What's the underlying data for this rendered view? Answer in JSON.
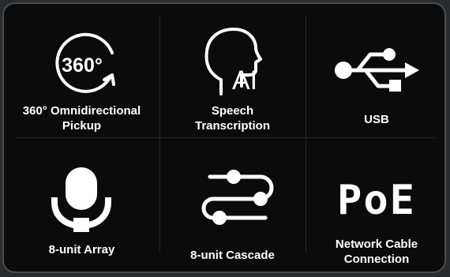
{
  "features": [
    {
      "icon": "360-rotate-icon",
      "icon_text": "360°",
      "label_lines": [
        "360° Omnidirectional",
        "Pickup"
      ]
    },
    {
      "icon": "ai-head-icon",
      "icon_text": "AI",
      "label_lines": [
        "Speech",
        "Transcription"
      ]
    },
    {
      "icon": "usb-icon",
      "label_lines": [
        "USB"
      ]
    },
    {
      "icon": "microphone-icon",
      "label_lines": [
        "8-unit Array"
      ]
    },
    {
      "icon": "cascade-sliders-icon",
      "label_lines": [
        "8-unit Cascade"
      ]
    },
    {
      "icon": "poe-icon",
      "icon_text": "PoE",
      "label_lines": [
        "Network Cable",
        "Connection"
      ]
    }
  ],
  "colors": {
    "background": "#0b0b0c",
    "border": "#4a4b50",
    "foreground": "#ffffff"
  }
}
